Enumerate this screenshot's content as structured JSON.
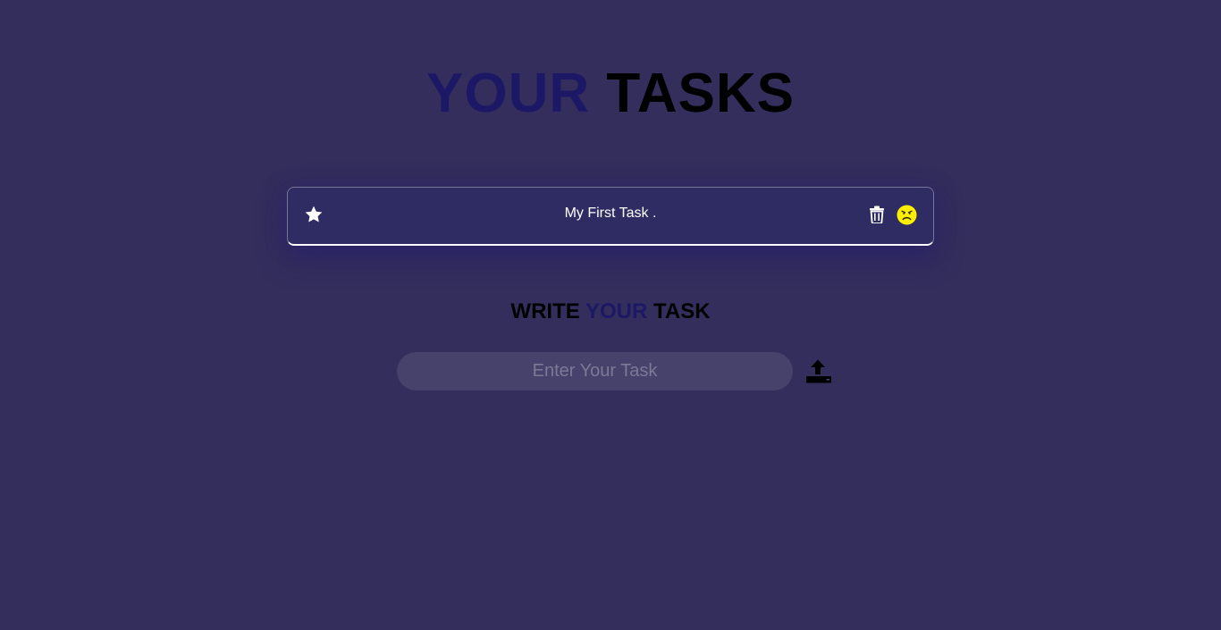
{
  "header": {
    "title_word1": "YOUR",
    "title_word2": "TASKS"
  },
  "tasks": [
    {
      "text": "My First Task .",
      "star_icon": "star-icon",
      "delete_icon": "trash-icon",
      "status_icon": "frown-face-icon"
    }
  ],
  "compose": {
    "heading_word1": "WRITE",
    "heading_word2": "YOUR",
    "heading_word3": "TASK",
    "input_value": "",
    "input_placeholder": "Enter Your Task",
    "submit_icon": "upload-icon"
  },
  "colors": {
    "background": "#332e5c",
    "accent": "#1d1866",
    "status_face": "#ffee00",
    "card_border": "#ffffff"
  }
}
